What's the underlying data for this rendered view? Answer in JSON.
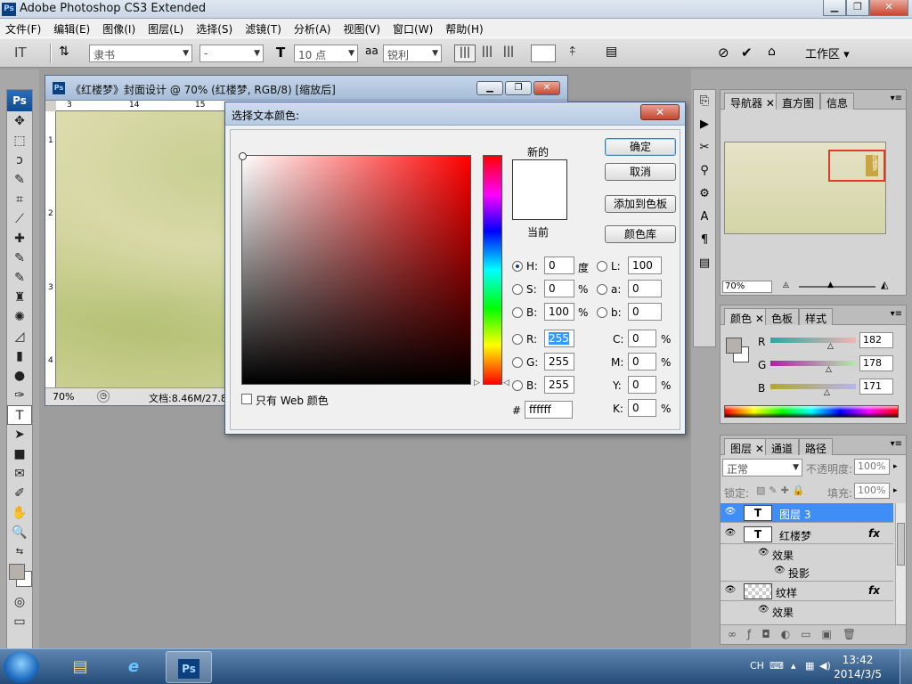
{
  "window": {
    "title": "Adobe Photoshop CS3 Extended",
    "app_icon": "Ps"
  },
  "menu": [
    "文件(F)",
    "编辑(E)",
    "图像(I)",
    "图层(L)",
    "选择(S)",
    "滤镜(T)",
    "分析(A)",
    "视图(V)",
    "窗口(W)",
    "帮助(H)"
  ],
  "options": {
    "tool_glyph": "IT",
    "font_family": "隶书",
    "font_style": "-",
    "font_size": "10 点",
    "aa_label": "aa",
    "anti_alias": "锐利",
    "workspace": "工作区 ▾"
  },
  "tools": {
    "header": "Ps",
    "glyphs": [
      "✥",
      "⬚",
      "ↄ",
      "✎",
      "⌗",
      "⟋",
      "✚",
      "✎",
      "✎",
      "♜",
      "✺",
      "◿",
      "▮",
      "◊",
      "●",
      "✑",
      "T",
      "➤",
      "■",
      "✉",
      "✐",
      "✋",
      "🔍",
      "⇆",
      "□",
      "◎",
      "▭"
    ]
  },
  "document": {
    "title": "《红楼梦》封面设计 @ 70% (红楼梦, RGB/8) [缩放后]",
    "ruler_h": [
      "3",
      "14",
      "15"
    ],
    "ruler_v": [
      "1",
      "2",
      "3",
      "4"
    ],
    "zoom": "70%",
    "status": "文档:8.46M/27.8"
  },
  "dialog": {
    "title": "选择文本颜色:",
    "new_label": "新的",
    "current_label": "当前",
    "buttons": {
      "ok": "确定",
      "cancel": "取消",
      "add": "添加到色板",
      "library": "颜色库"
    },
    "web_only": "只有 Web 颜色",
    "hsb": [
      {
        "label": "H:",
        "value": "0",
        "unit": "度",
        "selected": true
      },
      {
        "label": "S:",
        "value": "0",
        "unit": "%",
        "selected": false
      },
      {
        "label": "B:",
        "value": "100",
        "unit": "%",
        "selected": false
      }
    ],
    "lab": [
      {
        "label": "L:",
        "value": "100"
      },
      {
        "label": "a:",
        "value": "0"
      },
      {
        "label": "b:",
        "value": "0"
      }
    ],
    "rgb": [
      {
        "label": "R:",
        "value": "255"
      },
      {
        "label": "G:",
        "value": "255"
      },
      {
        "label": "B:",
        "value": "255"
      }
    ],
    "cmyk": [
      {
        "label": "C:",
        "value": "0",
        "unit": "%"
      },
      {
        "label": "M:",
        "value": "0",
        "unit": "%"
      },
      {
        "label": "Y:",
        "value": "0",
        "unit": "%"
      },
      {
        "label": "K:",
        "value": "0",
        "unit": "%"
      }
    ],
    "hash": "#",
    "hex": "ffffff",
    "new_color": "#ffffff"
  },
  "navigator": {
    "tabs": [
      "导航器",
      "直方图",
      "信息"
    ],
    "zoom": "70%",
    "thumb_text": "红楼梦"
  },
  "color_panel": {
    "tabs": [
      "颜色",
      "色板",
      "样式"
    ],
    "channels": [
      {
        "label": "R",
        "value": "182",
        "level": 0.71
      },
      {
        "label": "G",
        "value": "178",
        "level": 0.7
      },
      {
        "label": "B",
        "value": "171",
        "level": 0.67
      }
    ],
    "fg_color": "#b6b2ab"
  },
  "layers_panel": {
    "tabs": [
      "图层",
      "通道",
      "路径"
    ],
    "blend_mode": "正常",
    "opacity_label": "不透明度:",
    "opacity": "100%",
    "lock_label": "锁定:",
    "fill_label": "填充:",
    "fill": "100%",
    "rows": [
      {
        "name": "图层 3",
        "type": "T",
        "selected": true,
        "fx": ""
      },
      {
        "name": "红楼梦",
        "type": "T",
        "selected": false,
        "fx": "fx"
      },
      {
        "name": "效果",
        "type": "effect",
        "selected": false,
        "fx": ""
      },
      {
        "name": "投影",
        "type": "subeffect",
        "selected": false,
        "fx": ""
      },
      {
        "name": "纹样",
        "type": "pattern",
        "selected": false,
        "fx": "fx"
      },
      {
        "name": "效果",
        "type": "effect",
        "selected": false,
        "fx": ""
      }
    ]
  },
  "taskbar": {
    "items": [
      "explorer-icon",
      "ie-icon",
      "photoshop-icon"
    ],
    "ps_label": "Ps",
    "ie_label": "e",
    "folder_label": "▤",
    "lang": "CH",
    "time": "13:42",
    "date": "2014/3/5"
  }
}
